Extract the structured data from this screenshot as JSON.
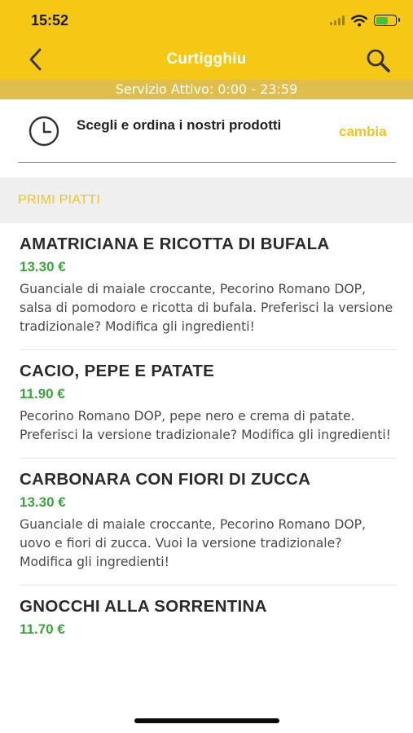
{
  "status_bar": {
    "time": "15:52"
  },
  "nav": {
    "title": "Curtigghiu"
  },
  "service": {
    "text": "Servizio Attivo: 0:00 - 23:59"
  },
  "order": {
    "text": "Scegli e ordina i nostri prodotti",
    "change_label": "cambia"
  },
  "section": {
    "title": "PRIMI PIATTI"
  },
  "items": [
    {
      "name": "AMATRICIANA E RICOTTA DI BUFALA",
      "price": "13.30 €",
      "description": "Guanciale di maiale croccante, Pecorino Romano DOP, salsa di pomodoro e ricotta di bufala. Preferisci la versione tradizionale? Modifica gli ingredienti!"
    },
    {
      "name": "CACIO, PEPE E PATATE",
      "price": "11.90 €",
      "description": "Pecorino Romano DOP, pepe nero e crema di patate. Preferisci la versione tradizionale? Modifica gli ingredienti!"
    },
    {
      "name": "CARBONARA CON FIORI DI ZUCCA",
      "price": "13.30 €",
      "description": "Guanciale di maiale croccante, Pecorino Romano DOP, uovo e fiori di zucca. Vuoi la versione tradizionale? Modifica gli ingredienti!"
    },
    {
      "name": "GNOCCHI ALLA SORRENTINA",
      "price": "11.70 €",
      "description": ""
    }
  ],
  "colors": {
    "brand_yellow": "#f6c816",
    "service_bar": "#dfbe4c",
    "accent_text": "#f3c21c",
    "price_green": "#3aa63a"
  },
  "icons": {
    "back": "chevron-left-icon",
    "search": "search-icon",
    "clock": "clock-icon",
    "wifi": "wifi-icon",
    "signal": "signal-icon",
    "battery": "battery-icon"
  }
}
